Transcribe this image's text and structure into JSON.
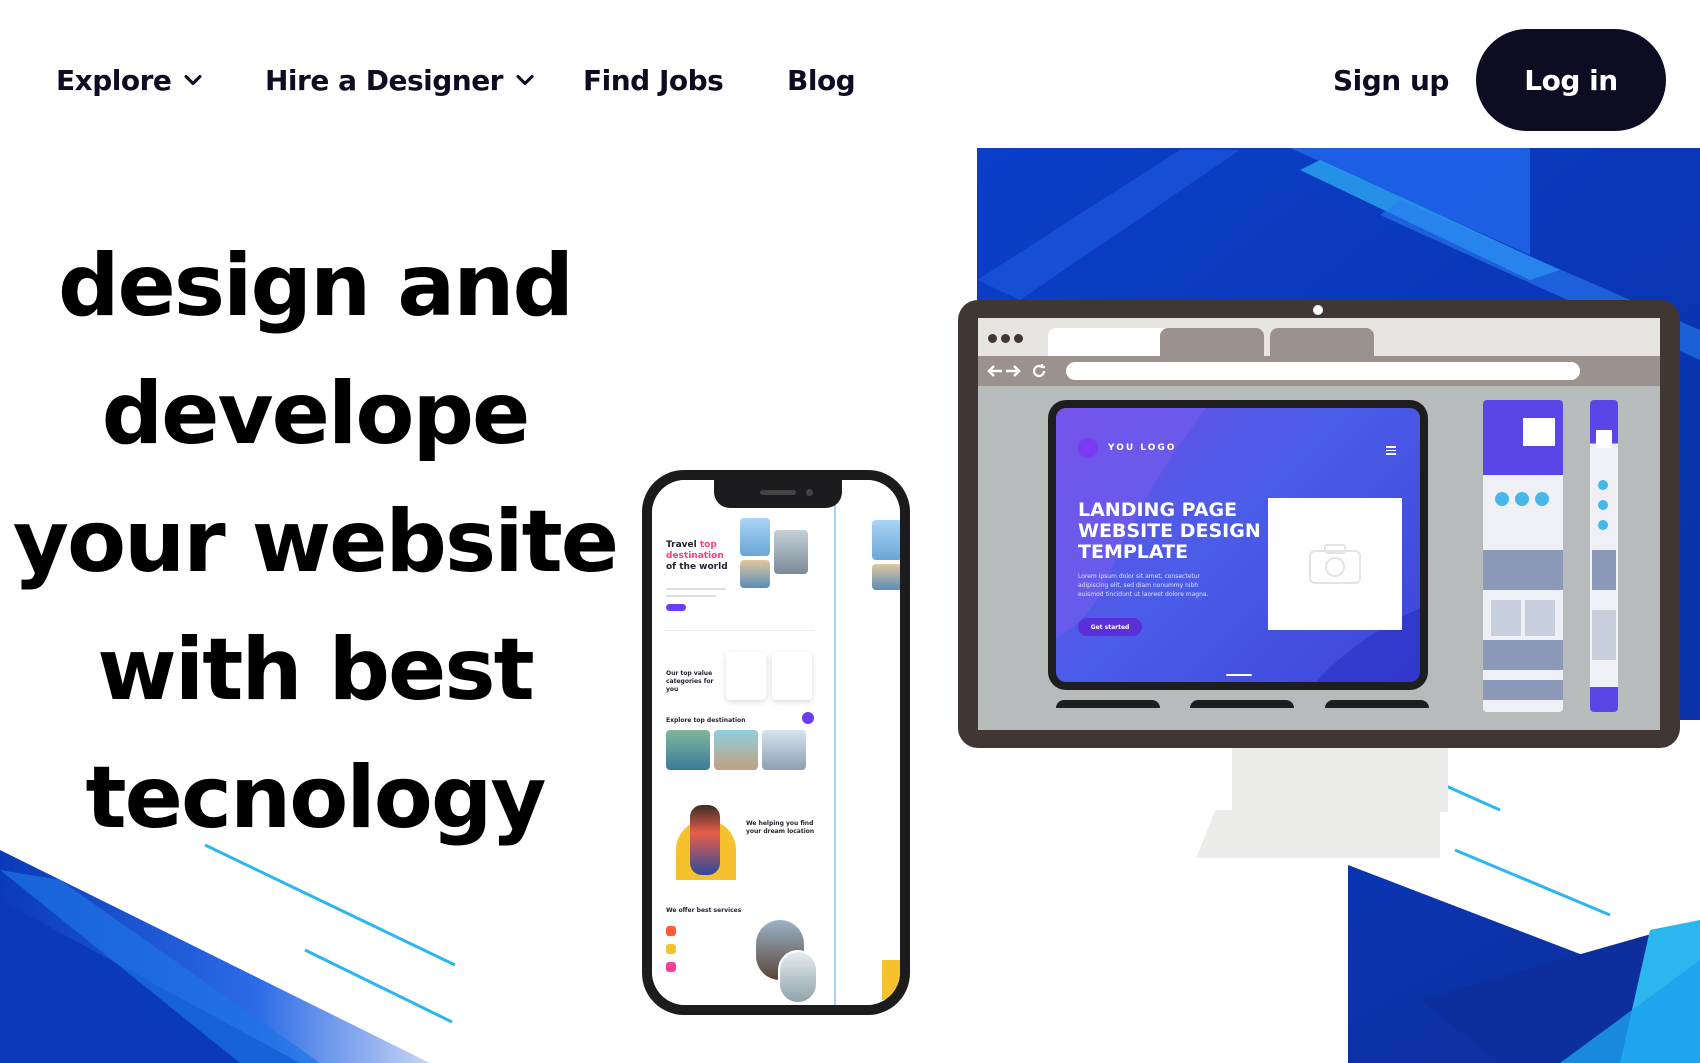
{
  "nav": {
    "explore": "Explore",
    "hire": "Hire a Designer",
    "find_jobs": "Find Jobs",
    "blog": "Blog",
    "sign_up": "Sign up",
    "log_in": "Log in"
  },
  "hero": {
    "lines": [
      "design and",
      "develope",
      "your website",
      "with best",
      "tecnology"
    ]
  },
  "phone": {
    "title_a": "Travel ",
    "title_b": "top",
    "title_c": "destination",
    "title_d": "of the world",
    "section_1": "Our top value categories for you",
    "section_2": "Explore top destination",
    "section_3": "We helping you find your dream location",
    "section_4": "We offer best services"
  },
  "tablet": {
    "logo": "YOU LOGO",
    "title": "LANDING PAGE WEBSITE DESIGN TEMPLATE",
    "lorem": "Lorem ipsum dolor sit amet, consectetur adipiscing elit, sed diam nonummy nibh euismod tincidunt ut laoreet dolore magna.",
    "cta": "Get started"
  },
  "colors": {
    "brand_dark": "#0d0c22",
    "blue_deep": "#0a3ab8",
    "blue_mid": "#1f5de0",
    "cyan": "#2bb6f0",
    "monitor_frame": "#403634"
  },
  "icons": [
    "chevron-down-icon",
    "chevron-down-icon",
    "camera-icon",
    "refresh-icon",
    "arrow-left-icon",
    "arrow-right-icon"
  ]
}
